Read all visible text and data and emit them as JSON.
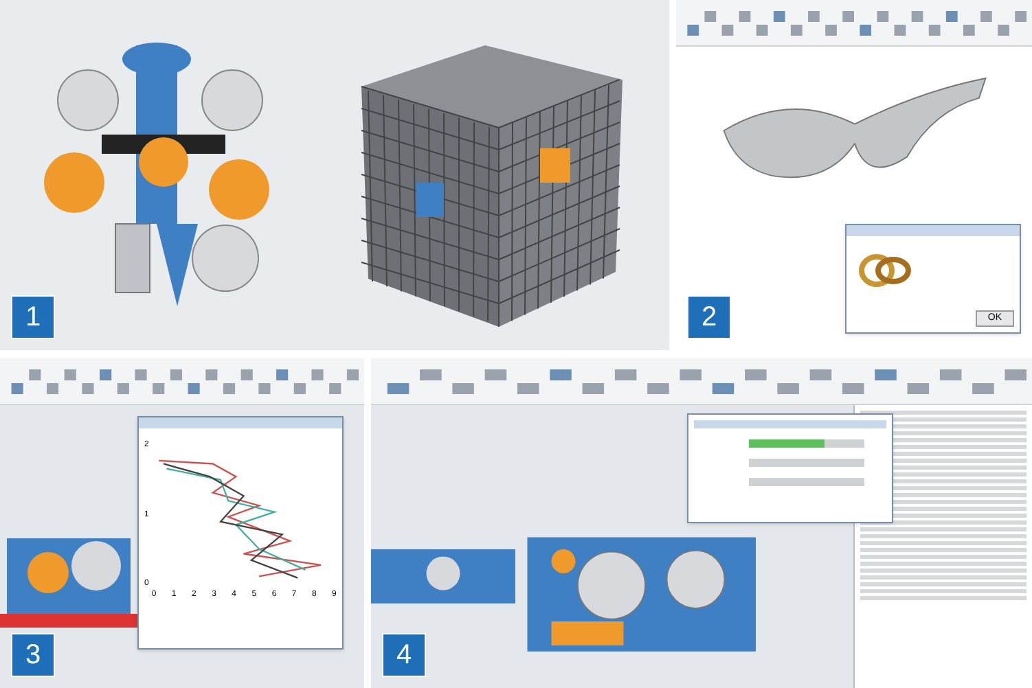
{
  "panels": [
    {
      "number": "1"
    },
    {
      "number": "2",
      "dialog": {
        "button": "OK"
      }
    },
    {
      "number": "3",
      "graph": {
        "x_ticks": [
          "0",
          "1",
          "2",
          "3",
          "4",
          "5",
          "6",
          "7",
          "8",
          "9"
        ],
        "y_ticks": [
          "2",
          "1",
          "0"
        ]
      }
    },
    {
      "number": "4",
      "progress": [
        {
          "level": 0.65
        }
      ]
    }
  ]
}
